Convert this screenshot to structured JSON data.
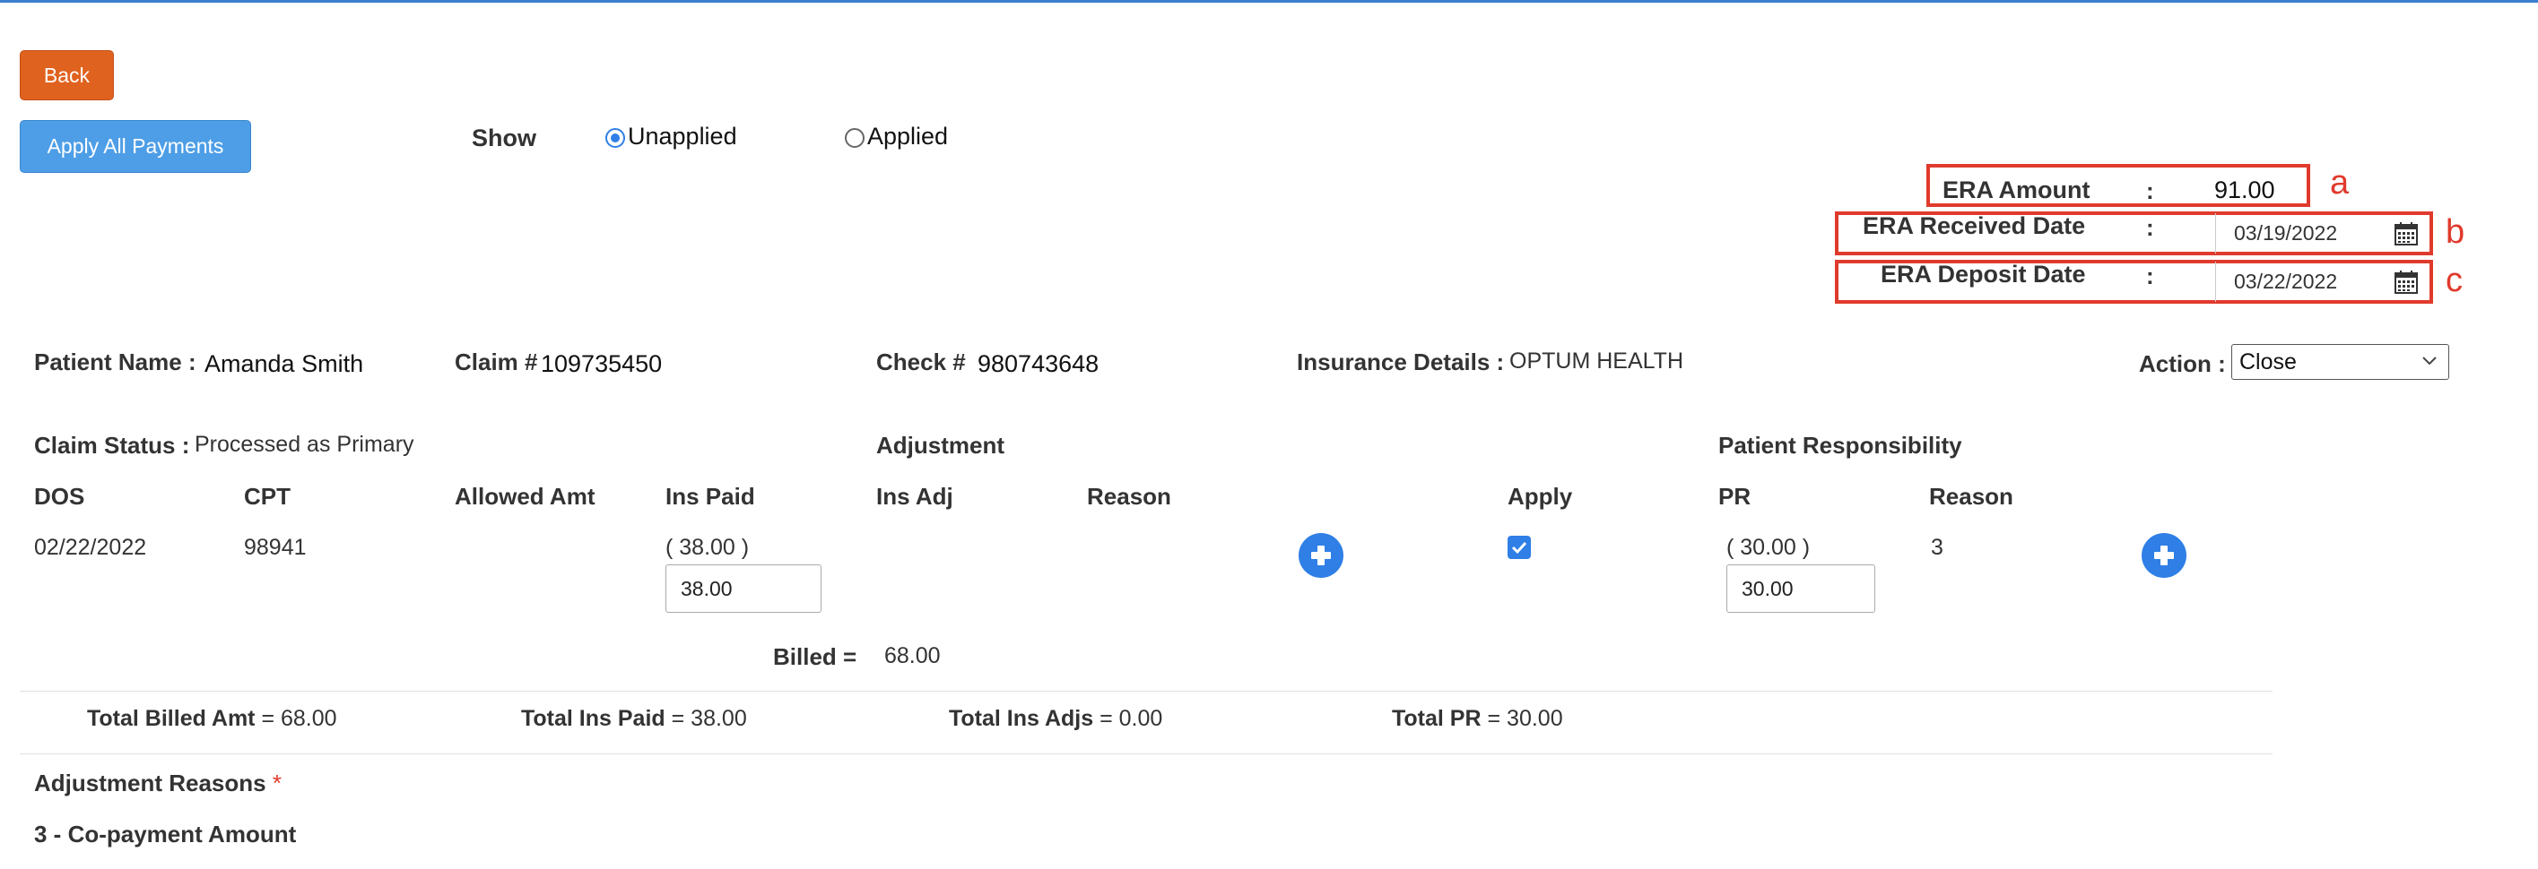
{
  "buttons": {
    "back": "Back",
    "apply_all": "Apply All Payments"
  },
  "show": {
    "label": "Show",
    "unapplied": "Unapplied",
    "applied": "Applied",
    "selected": "Unapplied"
  },
  "era": {
    "amount_label": "ERA Amount",
    "amount_value": "91.00",
    "received_label": "ERA Received Date",
    "received_value": "03/19/2022",
    "deposit_label": "ERA Deposit Date",
    "deposit_value": "03/22/2022",
    "colon": ":"
  },
  "annotations": {
    "a": "a",
    "b": "b",
    "c": "c"
  },
  "claim": {
    "patient_label": "Patient Name :",
    "patient_value": "Amanda Smith",
    "claim_label": "Claim #",
    "claim_value": "109735450",
    "check_label": "Check #",
    "check_value": "980743648",
    "insurance_label": "Insurance Details :",
    "insurance_value": "OPTUM HEALTH",
    "action_label": "Action :",
    "action_value": "Close",
    "status_label": "Claim Status :",
    "status_value": "Processed as Primary"
  },
  "sections": {
    "adjustment": "Adjustment",
    "patient_responsibility": "Patient Responsibility"
  },
  "columns": {
    "dos": "DOS",
    "cpt": "CPT",
    "allowed": "Allowed Amt",
    "ins_paid": "Ins Paid",
    "ins_adj": "Ins Adj",
    "reason": "Reason",
    "apply": "Apply",
    "pr": "PR",
    "pr_reason": "Reason"
  },
  "row": {
    "dos": "02/22/2022",
    "cpt": "98941",
    "ins_paid_display": "( 38.00 )",
    "ins_paid_input": "38.00",
    "apply_checked": true,
    "pr_display": "( 30.00 )",
    "pr_input": "30.00",
    "pr_reason": "3"
  },
  "billed": {
    "label": "Billed =",
    "value": "68.00"
  },
  "totals": {
    "billed_label": "Total Billed Amt",
    "billed_value": "= 68.00",
    "ins_paid_label": "Total Ins Paid",
    "ins_paid_value": "= 38.00",
    "ins_adjs_label": "Total Ins Adjs",
    "ins_adjs_value": "= 0.00",
    "pr_label": "Total PR",
    "pr_value": "= 30.00"
  },
  "adjustment_reasons": {
    "title": "Adjustment Reasons",
    "required_mark": "*",
    "item": "3 - Co-payment Amount"
  },
  "colors": {
    "back_button": "#e0621f",
    "apply_button": "#4d9ee6",
    "accent": "#2f7fe6",
    "annotation_red": "#e03a2c"
  },
  "icons": [
    "calendar-icon",
    "chevron-down-icon",
    "plus-circle-icon",
    "checkbox-checked-icon"
  ]
}
